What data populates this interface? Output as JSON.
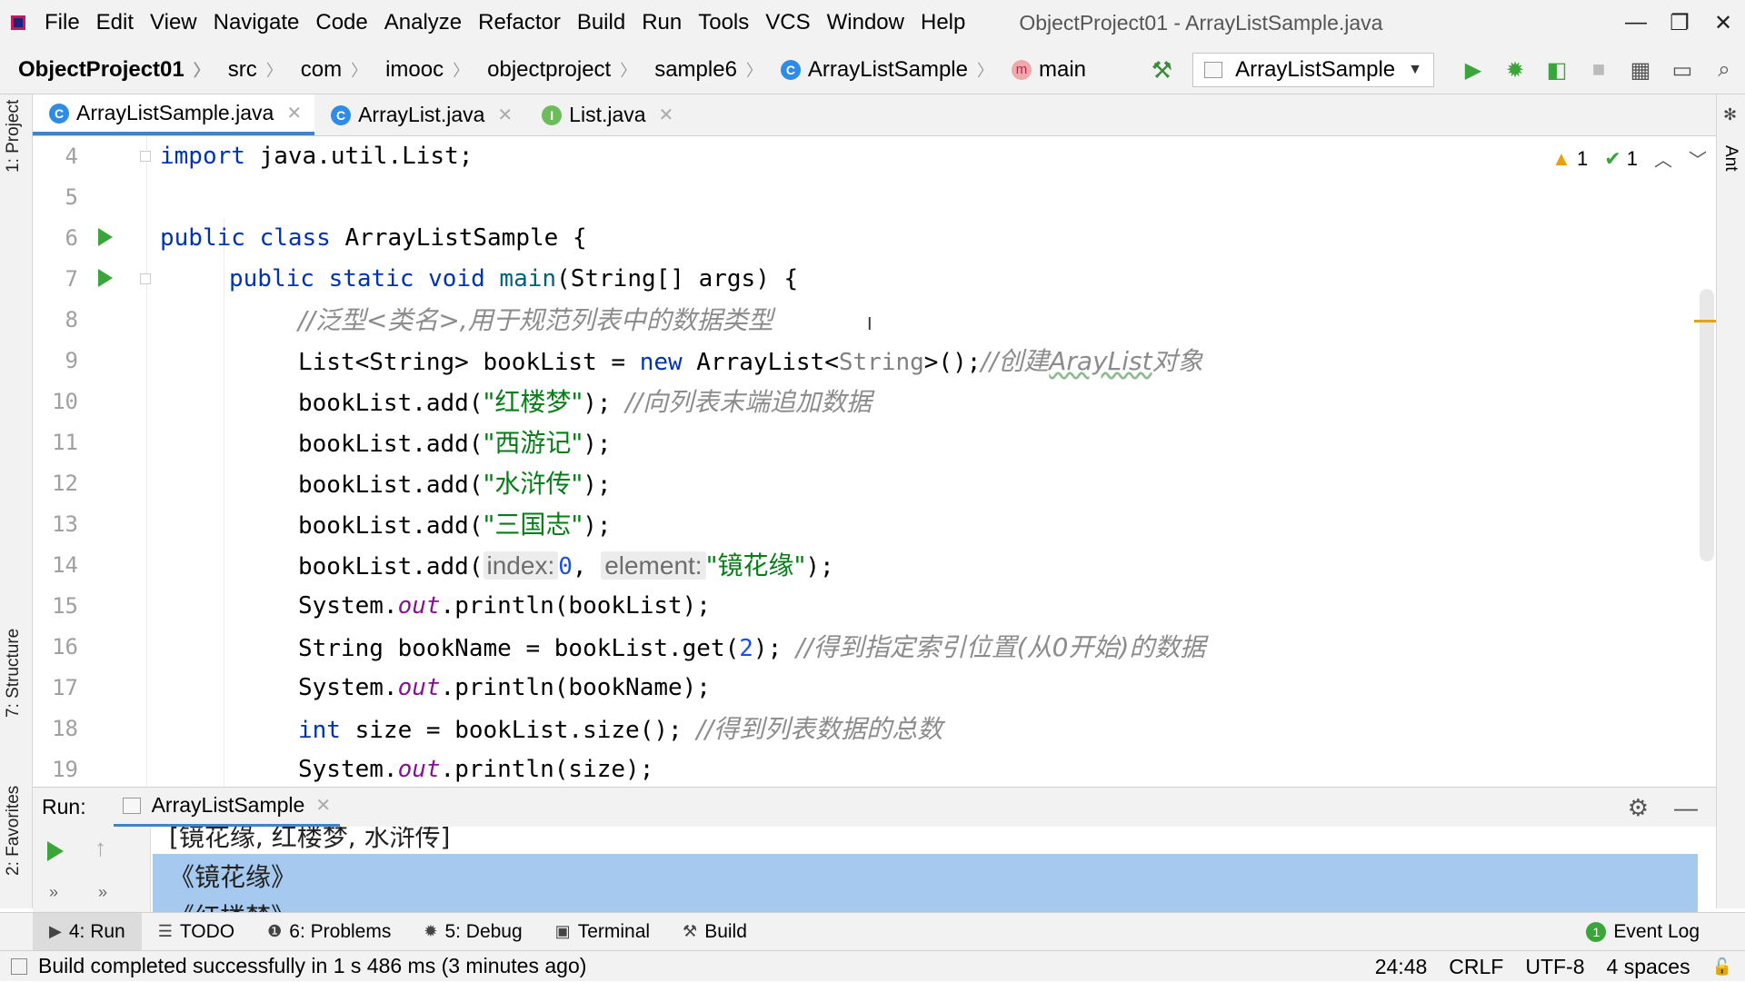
{
  "menu": [
    "File",
    "Edit",
    "View",
    "Navigate",
    "Code",
    "Analyze",
    "Refactor",
    "Build",
    "Run",
    "Tools",
    "VCS",
    "Window",
    "Help"
  ],
  "window_title": "ObjectProject01 - ArrayListSample.java",
  "window_controls": {
    "minimize": "—",
    "restore": "❐",
    "close": "✕"
  },
  "breadcrumbs": [
    "ObjectProject01",
    "src",
    "com",
    "imooc",
    "objectproject",
    "sample6",
    "ArrayListSample",
    "main"
  ],
  "run_config": {
    "label": "ArrayListSample"
  },
  "editor_tabs": [
    {
      "label": "ArrayListSample.java",
      "icon": "C"
    },
    {
      "label": "ArrayList.java",
      "icon": "C"
    },
    {
      "label": "List.java",
      "icon": "I"
    }
  ],
  "left_tools": {
    "project": "1: Project",
    "structure": "7: Structure",
    "favorites": "2: Favorites"
  },
  "right_tools": {
    "ant": "Ant"
  },
  "inspections": {
    "warnings": "1",
    "ok": "1"
  },
  "code": {
    "line_numbers": [
      "4",
      "5",
      "6",
      "7",
      "8",
      "9",
      "10",
      "11",
      "12",
      "13",
      "14",
      "15",
      "16",
      "17",
      "18",
      "19"
    ],
    "l4_kw": "import",
    "l4_rest": " java.util.List;",
    "l6_kw": "public class",
    "l6_rest": " ArrayListSample {",
    "l7_kw1": "public static void",
    "l7_name": " main",
    "l7_rest": "(String[] args) {",
    "l8_comment": "//泛型<类名>,用于规范列表中的数据类型",
    "l9_a": "List<String> bookList = ",
    "l9_new": "new",
    "l9_b": " ArrayList<",
    "l9_gen": "String",
    "l9_c": ">();",
    "l9_cm1": "//创建",
    "l9_cm2": "ArayList",
    "l9_cm3": "对象",
    "l10_a": "bookList.add(",
    "l10_str": "\"红楼梦\"",
    "l10_b": "); ",
    "l10_cm": "//向列表末端追加数据",
    "l11_a": "bookList.add(",
    "l11_str": "\"西游记\"",
    "l11_b": ");",
    "l12_a": "bookList.add(",
    "l12_str": "\"水浒传\"",
    "l12_b": ");",
    "l13_a": "bookList.add(",
    "l13_str": "\"三国志\"",
    "l13_b": ");",
    "l14_a": "bookList.add(",
    "l14_h1": "index:",
    "l14_num": "0",
    "l14_sep": ", ",
    "l14_h2": "element:",
    "l14_str": "\"镜花缘\"",
    "l14_b": ");",
    "l15_a": "System.",
    "l15_out": "out",
    "l15_b": ".println(bookList);",
    "l16_a": "String bookName = bookList.get(",
    "l16_num": "2",
    "l16_b": "); ",
    "l16_cm": "//得到指定索引位置(从0开始)的数据",
    "l17_a": "System.",
    "l17_out": "out",
    "l17_b": ".println(bookName);",
    "l18_kw": "int",
    "l18_a": " size = bookList.size(); ",
    "l18_cm": "//得到列表数据的总数",
    "l19_a": "System.",
    "l19_out": "out",
    "l19_b": ".println(size);"
  },
  "run_panel": {
    "label": "Run:",
    "tab": "ArrayListSample",
    "output": [
      "[镜花缘, 红楼梦, 水浒传]",
      "《镜花缘》",
      "《红楼梦》"
    ]
  },
  "bottom_tabs": [
    {
      "label": "4: Run",
      "icon": "▶"
    },
    {
      "label": "TODO",
      "icon": "☰"
    },
    {
      "label": "6: Problems",
      "icon": "❶"
    },
    {
      "label": "5: Debug",
      "icon": "✹"
    },
    {
      "label": "Terminal",
      "icon": "▣"
    },
    {
      "label": "Build",
      "icon": "⚒"
    }
  ],
  "event_log": {
    "label": "Event Log",
    "count": "1"
  },
  "status": {
    "message": "Build completed successfully in 1 s 486 ms (3 minutes ago)",
    "position": "24:48",
    "line_sep": "CRLF",
    "encoding": "UTF-8",
    "indent": "4 spaces"
  },
  "colors": {
    "keyword": "#0033b3",
    "string": "#067d17",
    "comment": "#8c8c8c",
    "static_field": "#871094",
    "number": "#1750eb",
    "accent": "#4083c9",
    "run_green": "#3aa63a"
  }
}
